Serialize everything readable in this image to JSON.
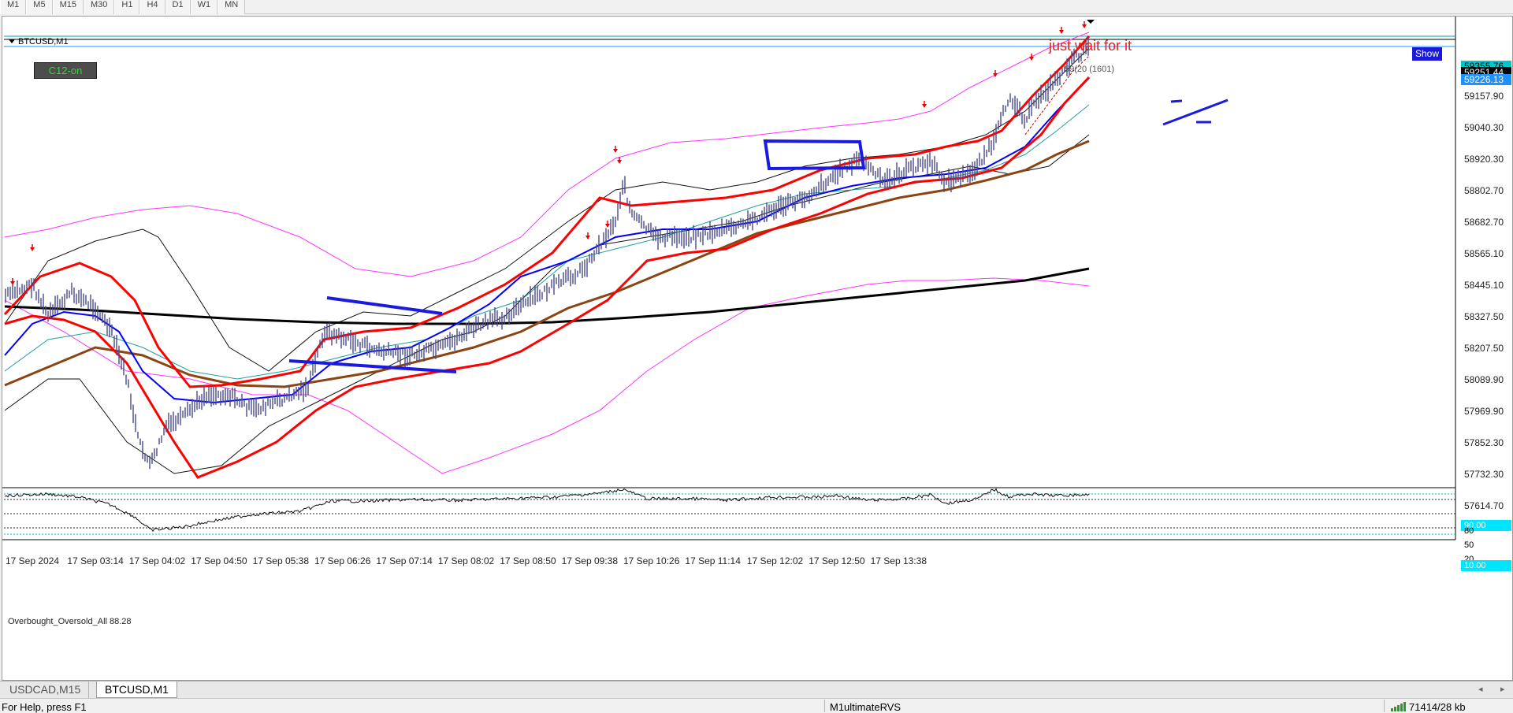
{
  "toolbar": {
    "timeframes": [
      "M1",
      "M5",
      "M15",
      "M30",
      "H1",
      "H4",
      "D1",
      "W1",
      "MN"
    ]
  },
  "chart": {
    "symbol": "BTCUSD,M1",
    "indicator_button": "C12-on",
    "annotation": "just wait for it",
    "show_button": "Show",
    "line_label": "59(20 (1601)",
    "subwindow_title": "Overbought_Oversold_All 88.28",
    "colors": {
      "candles": "#4a4a8a",
      "red_band": "#ff0000",
      "blue_ma": "#0000ff",
      "brown_ma": "#8b4513",
      "black_ma": "#000000",
      "magenta_band": "#ff00ff",
      "teal_ma": "#20a0a0",
      "bid_badge": "#000000",
      "ask_badge": "#1e90ff",
      "level_badge": "#00e5ff"
    }
  },
  "price_axis": {
    "current_bid": "59251.44",
    "current_ask": "59226.13",
    "top_partial": "59355.76",
    "ticks": [
      "59157.90",
      "59040.30",
      "58920.30",
      "58802.70",
      "58682.70",
      "58565.10",
      "58445.10",
      "58327.50",
      "58207.50",
      "58089.90",
      "57969.90",
      "57852.30",
      "57732.30",
      "57614.70"
    ]
  },
  "oscillator_axis": {
    "levels": [
      "90.00",
      "80",
      "50",
      "20",
      "10.00"
    ],
    "current_value": "88.28"
  },
  "time_axis": {
    "labels": [
      "17 Sep 2024",
      "17 Sep 03:14",
      "17 Sep 04:02",
      "17 Sep 04:50",
      "17 Sep 05:38",
      "17 Sep 06:26",
      "17 Sep 07:14",
      "17 Sep 08:02",
      "17 Sep 08:50",
      "17 Sep 09:38",
      "17 Sep 10:26",
      "17 Sep 11:14",
      "17 Sep 12:02",
      "17 Sep 12:50",
      "17 Sep 13:38"
    ]
  },
  "tabs": [
    {
      "label": "USDCAD,M15",
      "active": false
    },
    {
      "label": "BTCUSD,M1",
      "active": true
    }
  ],
  "status_bar": {
    "help_text": "For Help, press F1",
    "profile": "M1ultimateRVS",
    "traffic": "71414/28 kb"
  }
}
